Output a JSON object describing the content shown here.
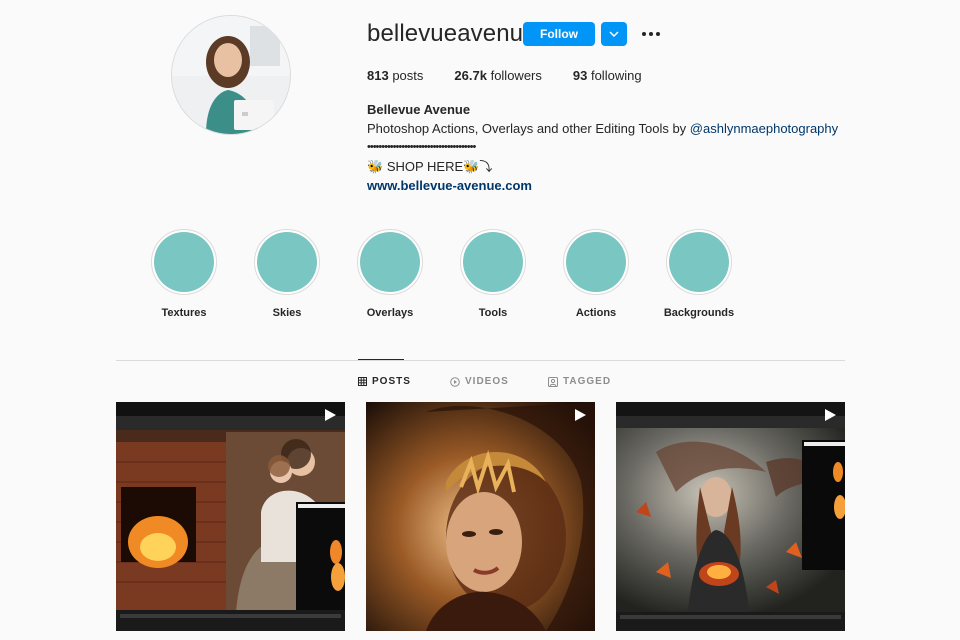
{
  "profile": {
    "username": "bellevueavenue",
    "follow_label": "Follow",
    "stats": {
      "posts_count": "813",
      "posts_label": "posts",
      "followers_count": "26.7k",
      "followers_label": "followers",
      "following_count": "93",
      "following_label": "following"
    },
    "bio": {
      "name": "Bellevue Avenue",
      "line1_text": "Photoshop Actions, Overlays and other Editing Tools by ",
      "line1_mention": "@ashlynmaephotography",
      "dots": "••••••••••••••••••••••••••••••••••••••",
      "shop_text": "SHOP HERE",
      "shop_emoji_left": "🐝",
      "shop_emoji_right": "🐝⤵",
      "website": "www.bellevue-avenue.com"
    }
  },
  "highlights": [
    {
      "label": "Textures"
    },
    {
      "label": "Skies"
    },
    {
      "label": "Overlays"
    },
    {
      "label": "Tools"
    },
    {
      "label": "Actions"
    },
    {
      "label": "Backgrounds"
    }
  ],
  "tabs": [
    {
      "label": "POSTS",
      "icon": "grid-icon",
      "active": true
    },
    {
      "label": "VIDEOS",
      "icon": "play-circle-icon",
      "active": false
    },
    {
      "label": "TAGGED",
      "icon": "tag-icon",
      "active": false
    }
  ],
  "posts": [
    {
      "icon": "reel-play-icon",
      "subject": "fireplace-mother-child"
    },
    {
      "icon": "reel-play-icon",
      "subject": "golden-leaf-portrait"
    },
    {
      "icon": "reel-play-icon",
      "subject": "fire-woman-portrait"
    }
  ],
  "colors": {
    "accent": "#0095f6",
    "highlight_fill": "#7ac6c2",
    "link": "#00376b",
    "text": "#262626",
    "muted": "#8e8e8e",
    "background": "#fafafa"
  }
}
